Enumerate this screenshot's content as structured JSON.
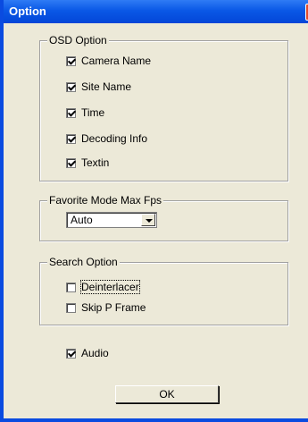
{
  "window": {
    "title": "Option",
    "close_glyph": "✕"
  },
  "osd": {
    "legend": "OSD Option",
    "items": [
      {
        "label": "Camera Name",
        "checked": true
      },
      {
        "label": "Site Name",
        "checked": true
      },
      {
        "label": "Time",
        "checked": true
      },
      {
        "label": "Decoding Info",
        "checked": true
      },
      {
        "label": "Textin",
        "checked": true
      }
    ]
  },
  "favorite": {
    "legend": "Favorite Mode Max Fps",
    "selected": "Auto"
  },
  "search": {
    "legend": "Search Option",
    "items": [
      {
        "label": "Deinterlacer",
        "checked": false
      },
      {
        "label": "Skip P Frame",
        "checked": false
      }
    ]
  },
  "audio": {
    "label": "Audio",
    "checked": true
  },
  "ok_label": "OK",
  "colors": {
    "titlebar": "#0a58e6",
    "dialog_bg": "#ece9d8"
  }
}
